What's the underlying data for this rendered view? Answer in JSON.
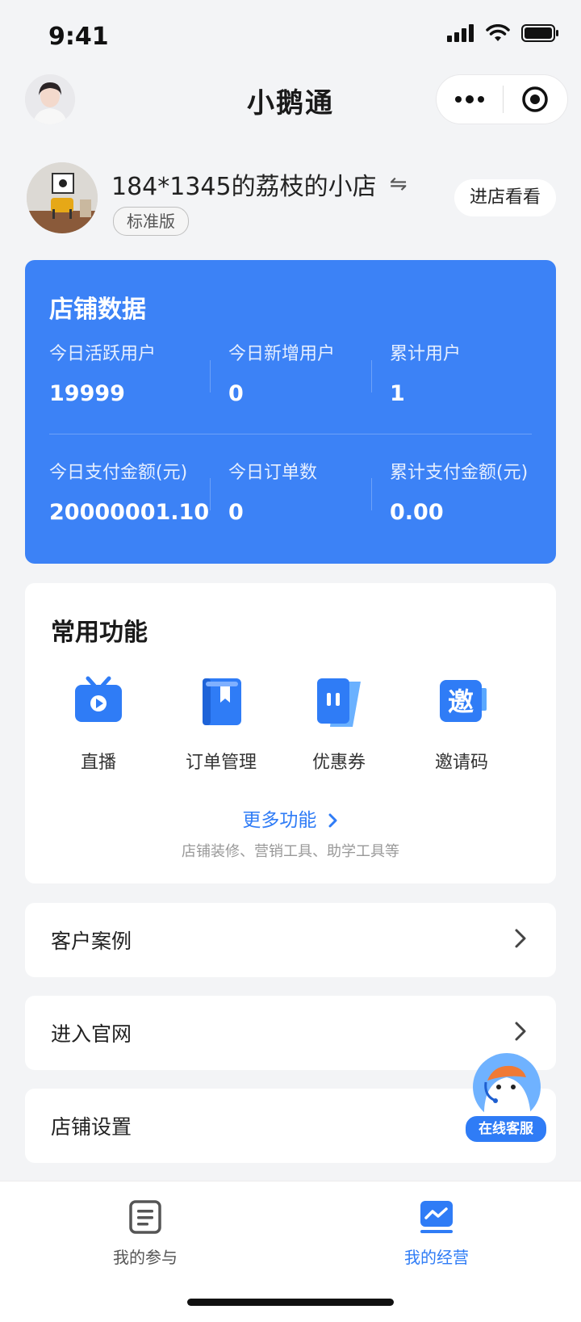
{
  "status_bar": {
    "time": "9:41"
  },
  "nav": {
    "title": "小鹅通"
  },
  "shop": {
    "name": "184*1345的荔枝的小店",
    "edition": "标准版",
    "visit_label": "进店看看"
  },
  "store_data": {
    "title": "店铺数据",
    "metrics": [
      {
        "label": "今日活跃用户",
        "value": "19999"
      },
      {
        "label": "今日新增用户",
        "value": "0"
      },
      {
        "label": "累计用户",
        "value": "1"
      },
      {
        "label": "今日支付金额(元)",
        "value": "20000001.10"
      },
      {
        "label": "今日订单数",
        "value": "0"
      },
      {
        "label": "累计支付金额(元)",
        "value": "0.00"
      }
    ]
  },
  "functions": {
    "title": "常用功能",
    "items": [
      {
        "label": "直播",
        "icon": "live-tv-icon"
      },
      {
        "label": "订单管理",
        "icon": "order-book-icon"
      },
      {
        "label": "优惠券",
        "icon": "coupon-icon"
      },
      {
        "label": "邀请码",
        "icon": "invite-code-icon"
      }
    ],
    "more_label": "更多功能",
    "more_sub": "店铺装修、营销工具、助学工具等"
  },
  "rows": [
    {
      "label": "客户案例"
    },
    {
      "label": "进入官网"
    },
    {
      "label": "店铺设置"
    }
  ],
  "service": {
    "label": "在线客服"
  },
  "tabbar": {
    "items": [
      {
        "label": "我的参与",
        "active": false
      },
      {
        "label": "我的经营",
        "active": true
      }
    ],
    "active_color": "#2f7cf6",
    "inactive_color": "#555555"
  },
  "colors": {
    "accent": "#3c82f6",
    "link": "#2f7cf6"
  }
}
